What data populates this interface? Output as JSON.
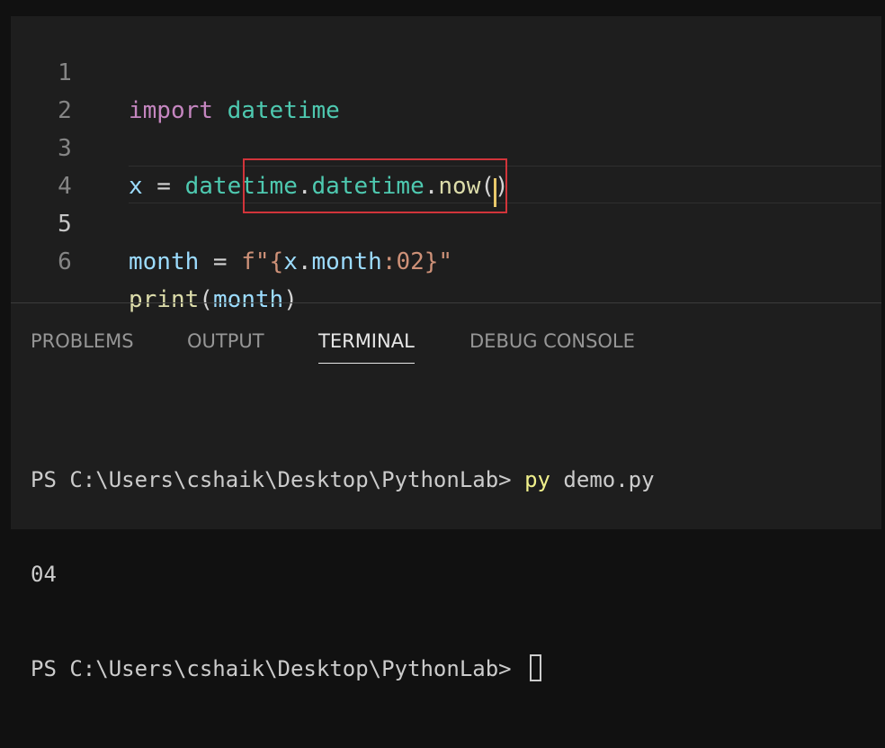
{
  "editor": {
    "lines": [
      {
        "num": "1",
        "t0": "import",
        "t1": " ",
        "t2": "datetime"
      },
      {
        "num": "2"
      },
      {
        "num": "3",
        "t0": "x",
        "t1": " = ",
        "t2": "datetime",
        "t3": ".",
        "t4": "datetime",
        "t5": ".",
        "t6": "now",
        "t7": "()"
      },
      {
        "num": "4"
      },
      {
        "num": "5",
        "t0": "month",
        "t1": " = ",
        "t2": "f\"{",
        "t3": "x",
        "t4": ".",
        "t5": "month",
        "t6": ":02}\""
      },
      {
        "num": "6",
        "t0": "print",
        "t1": "(",
        "t2": "month",
        "t3": ")"
      }
    ],
    "active_line": 5
  },
  "panel": {
    "tabs": [
      "PROBLEMS",
      "OUTPUT",
      "TERMINAL",
      "DEBUG CONSOLE"
    ],
    "active_tab": "TERMINAL"
  },
  "terminal": {
    "prompt1": "PS C:\\Users\\cshaik\\Desktop\\PythonLab> ",
    "command": "py",
    "args": " demo.py",
    "output": "04",
    "prompt2": "PS C:\\Users\\cshaik\\Desktop\\PythonLab> "
  },
  "colors": {
    "background": "#1e1e1e",
    "keyword": "#c586c0",
    "module": "#4ec9b0",
    "variable": "#9cdcfe",
    "function": "#dcdcaa",
    "string": "#ce9178",
    "highlight_box": "#d1343a",
    "command": "#f0f08c"
  }
}
